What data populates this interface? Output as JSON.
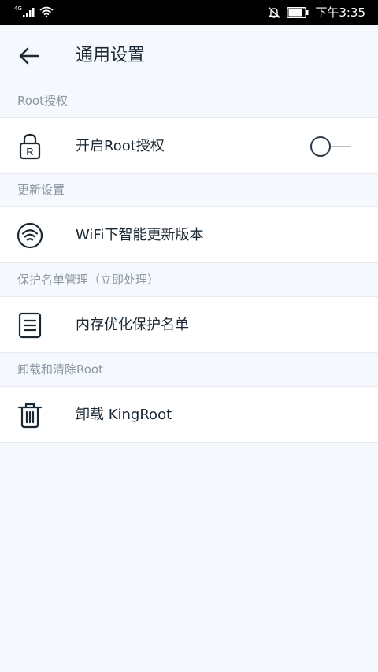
{
  "status_bar": {
    "network": "4G",
    "time": "下午3:35"
  },
  "header": {
    "title": "通用设置"
  },
  "sections": [
    {
      "title": "Root授权",
      "item": {
        "label": "开启Root授权",
        "icon": "lock-r-icon",
        "toggle_on": false
      }
    },
    {
      "title": "更新设置",
      "item": {
        "label": "WiFi下智能更新版本",
        "icon": "wifi-icon"
      }
    },
    {
      "title": "保护名单管理（立即处理）",
      "item": {
        "label": "内存优化保护名单",
        "icon": "document-list-icon"
      }
    },
    {
      "title": "卸载和清除Root",
      "item": {
        "label": "卸载 KingRoot",
        "icon": "trash-icon"
      }
    }
  ],
  "colors": {
    "background": "#f5f9fd",
    "row_background": "#ffffff",
    "section_text": "#8c97a3",
    "primary_text": "#1b2733"
  }
}
